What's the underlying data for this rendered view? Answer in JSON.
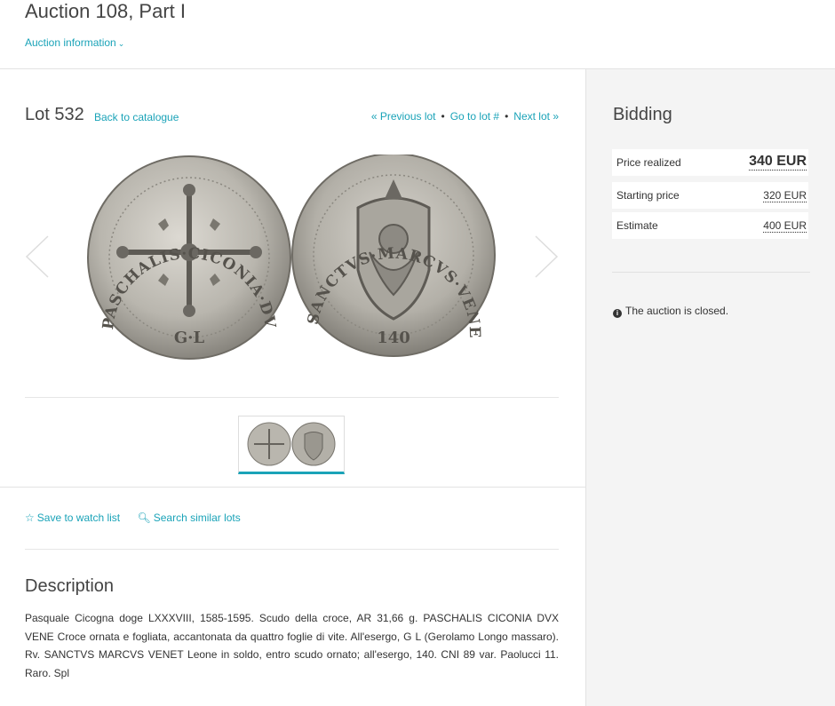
{
  "header": {
    "title": "Auction 108, Part I",
    "info_link": "Auction information"
  },
  "lot": {
    "title": "Lot 532",
    "back_link": "Back to catalogue",
    "prev": "« Previous lot",
    "goto": "Go to lot #",
    "next": "Next lot »"
  },
  "actions": {
    "watch": "Save to watch list",
    "similar": "Search similar lots"
  },
  "description": {
    "title": "Description",
    "text": "Pasquale Cicogna doge LXXXVIII, 1585-1595. Scudo della croce, AR 31,66 g. PASCHALIS CICONIA DVX VENE Croce ornata e fogliata, accantonata da quattro foglie di vite. All'esergo, G L (Gerolamo Longo massaro). Rv. SANCTVS MARCVS VENET Leone in soldo, entro scudo ornato; all'esergo, 140. CNI 89 var. Paolucci 11. Raro. Spl"
  },
  "bidding": {
    "title": "Bidding",
    "price_realized_label": "Price realized",
    "price_realized": "340 EUR",
    "starting_price_label": "Starting price",
    "starting_price": "320 EUR",
    "estimate_label": "Estimate",
    "estimate": "400 EUR",
    "status": "The auction is closed."
  },
  "coin": {
    "obverse_legend": "PASCHALIS·CICONIA·DVX·VENE",
    "obverse_exergue": "G·L",
    "reverse_legend": "SANCTVS·MARCVS·VENET",
    "reverse_exergue": "140"
  },
  "colors": {
    "accent": "#1aa3b8",
    "sidebar_bg": "#f4f4f4",
    "coin_silver": "#b9b6ae"
  }
}
